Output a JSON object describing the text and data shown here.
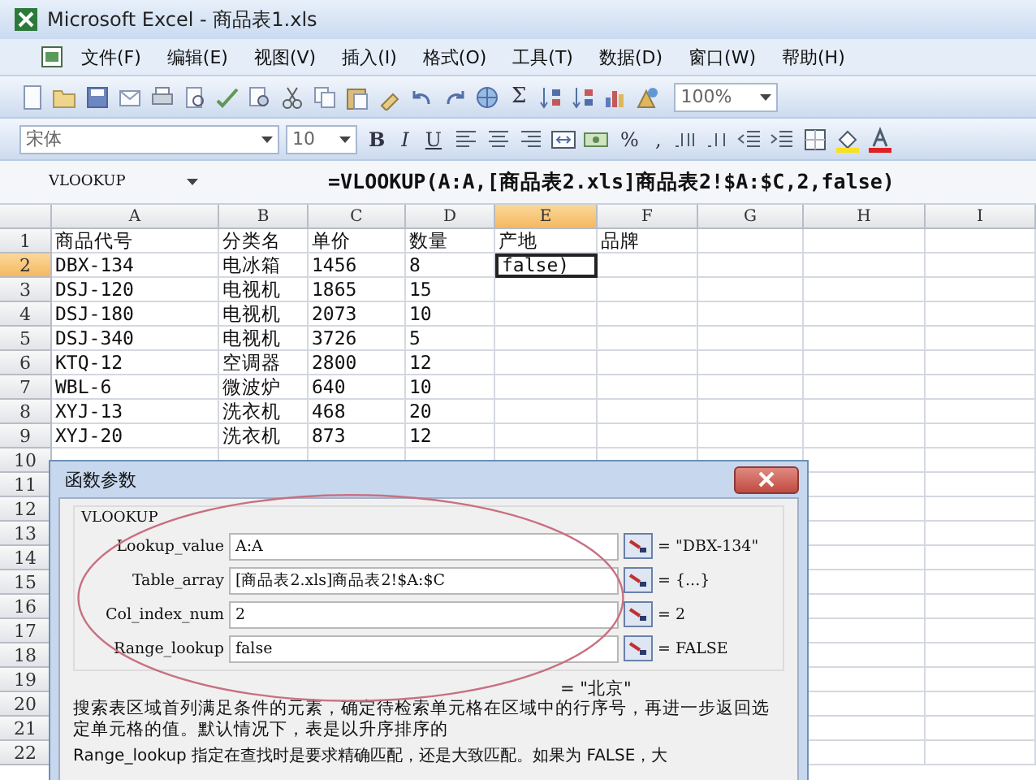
{
  "window": {
    "title": "Microsoft Excel - 商品表1.xls"
  },
  "menu": [
    "文件(F)",
    "编辑(E)",
    "视图(V)",
    "插入(I)",
    "格式(O)",
    "工具(T)",
    "数据(D)",
    "窗口(W)",
    "帮助(H)"
  ],
  "standard_toolbar": {
    "autosum": "Σ",
    "zoom": "100%"
  },
  "format_toolbar": {
    "font": "宋体",
    "size": "10",
    "style_buttons": [
      "B",
      "I",
      "U"
    ],
    "number_buttons": [
      "%",
      ","
    ]
  },
  "formula_bar": {
    "name_box": "VLOOKUP",
    "formula": "=VLOOKUP(A:A,[商品表2.xls]商品表2!$A:$C,2,false)"
  },
  "sheet": {
    "columns": [
      {
        "label": "A",
        "selected": false
      },
      {
        "label": "B",
        "selected": false
      },
      {
        "label": "C",
        "selected": false
      },
      {
        "label": "D",
        "selected": false
      },
      {
        "label": "E",
        "selected": true
      },
      {
        "label": "F",
        "selected": false
      },
      {
        "label": "G",
        "selected": false
      },
      {
        "label": "H",
        "selected": false
      },
      {
        "label": "I",
        "selected": false
      }
    ],
    "rows": [
      {
        "number": "1",
        "selected": false,
        "cells": [
          "商品代号",
          "分类名",
          "单价",
          "数量",
          "产地",
          "品牌"
        ]
      },
      {
        "number": "2",
        "selected": true,
        "cells": [
          "DBX-134",
          "电冰箱",
          "1456",
          "8",
          "false)"
        ]
      },
      {
        "number": "3",
        "selected": false,
        "cells": [
          "DSJ-120",
          "电视机",
          "1865",
          "15"
        ]
      },
      {
        "number": "4",
        "selected": false,
        "cells": [
          "DSJ-180",
          "电视机",
          "2073",
          "10"
        ]
      },
      {
        "number": "5",
        "selected": false,
        "cells": [
          "DSJ-340",
          "电视机",
          "3726",
          "5"
        ]
      },
      {
        "number": "6",
        "selected": false,
        "cells": [
          "KTQ-12",
          "空调器",
          "2800",
          "12"
        ]
      },
      {
        "number": "7",
        "selected": false,
        "cells": [
          "WBL-6",
          "微波炉",
          "640",
          "10"
        ]
      },
      {
        "number": "8",
        "selected": false,
        "cells": [
          "XYJ-13",
          "洗衣机",
          "468",
          "20"
        ]
      },
      {
        "number": "9",
        "selected": false,
        "cells": [
          "XYJ-20",
          "洗衣机",
          "873",
          "12"
        ]
      },
      {
        "number": "10",
        "selected": false,
        "cells": []
      },
      {
        "number": "11",
        "selected": false,
        "cells": []
      },
      {
        "number": "12",
        "selected": false,
        "cells": []
      },
      {
        "number": "13",
        "selected": false,
        "cells": []
      },
      {
        "number": "14",
        "selected": false,
        "cells": []
      },
      {
        "number": "15",
        "selected": false,
        "cells": []
      },
      {
        "number": "16",
        "selected": false,
        "cells": []
      },
      {
        "number": "17",
        "selected": false,
        "cells": []
      },
      {
        "number": "18",
        "selected": false,
        "cells": []
      },
      {
        "number": "19",
        "selected": false,
        "cells": []
      },
      {
        "number": "20",
        "selected": false,
        "cells": []
      },
      {
        "number": "21",
        "selected": false,
        "cells": []
      },
      {
        "number": "22",
        "selected": false,
        "cells": []
      }
    ]
  },
  "dialog": {
    "title": "函数参数",
    "function": "VLOOKUP",
    "params": [
      {
        "label": "Lookup_value",
        "value": "A:A",
        "result": "= \"DBX-134\""
      },
      {
        "label": "Table_array",
        "value": "[商品表2.xls]商品表2!$A:$C",
        "result": "= {...}"
      },
      {
        "label": "Col_index_num",
        "value": "2",
        "result": "= 2"
      },
      {
        "label": "Range_lookup",
        "value": "false",
        "result": "= FALSE"
      }
    ],
    "result": "= \"北京\"",
    "description": "搜索表区域首列满足条件的元素，确定待检索单元格在区域中的行序号，再进一步返回选定单元格的值。默认情况下，表是以升序排序的",
    "param_help": "Range_lookup  指定在查找时是要求精确匹配，还是大致匹配。如果为 FALSE，大"
  }
}
